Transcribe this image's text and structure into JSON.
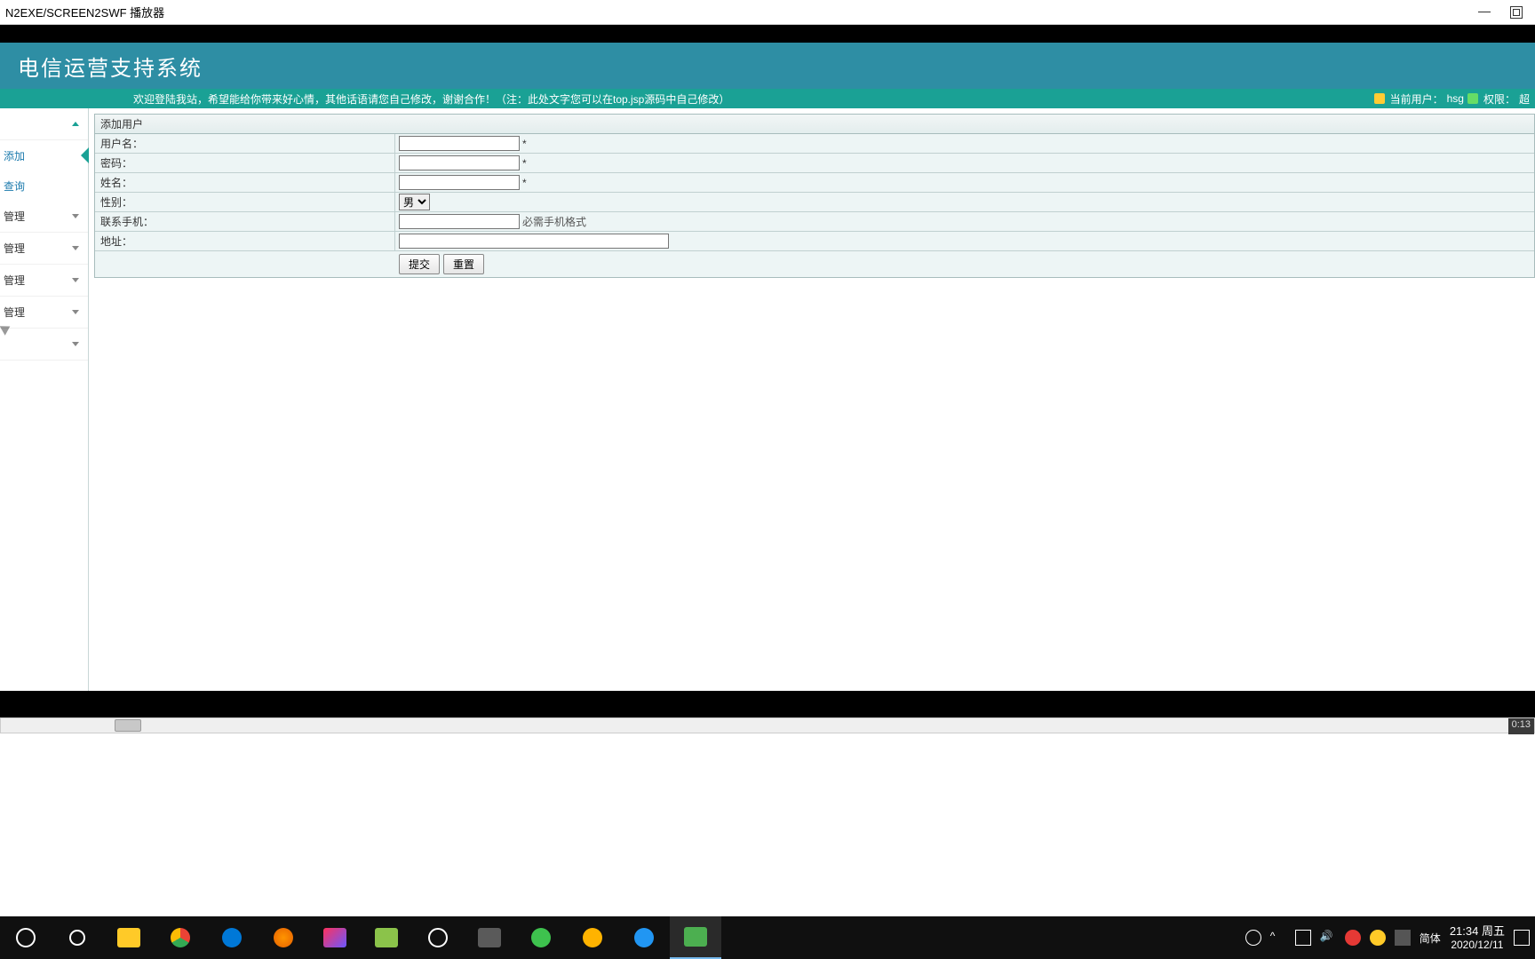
{
  "window": {
    "title": "N2EXE/SCREEN2SWF 播放器"
  },
  "app": {
    "banner_title": "电信运营支持系统",
    "welcome": "欢迎登陆我站，希望能给你带来好心情，其他话语请您自己修改，谢谢合作！（注：此处文字您可以在top.jsp源码中自己修改）",
    "user_label": "当前用户：",
    "user_value": "hsg",
    "role_label": "权限：",
    "role_value": "超"
  },
  "sidebar": {
    "items": [
      {
        "label": "",
        "expanded": true
      },
      {
        "label": "添加",
        "sub": true,
        "active": true
      },
      {
        "label": "查询",
        "sub": true
      },
      {
        "label": "管理"
      },
      {
        "label": "管理"
      },
      {
        "label": "管理"
      },
      {
        "label": "管理"
      },
      {
        "label": ""
      }
    ]
  },
  "form": {
    "title": "添加用户",
    "username_label": "用户名：",
    "password_label": "密码：",
    "name_label": "姓名：",
    "gender_label": "性别：",
    "gender_value": "男",
    "phone_label": "联系手机：",
    "phone_hint": "必需手机格式",
    "address_label": "地址：",
    "required_mark": "*",
    "submit_label": "提交",
    "reset_label": "重置"
  },
  "player": {
    "timecode": "0:13"
  },
  "systray": {
    "ime": "简体",
    "time": "21:34",
    "weekday": "周五",
    "date": "2020/12/11"
  }
}
